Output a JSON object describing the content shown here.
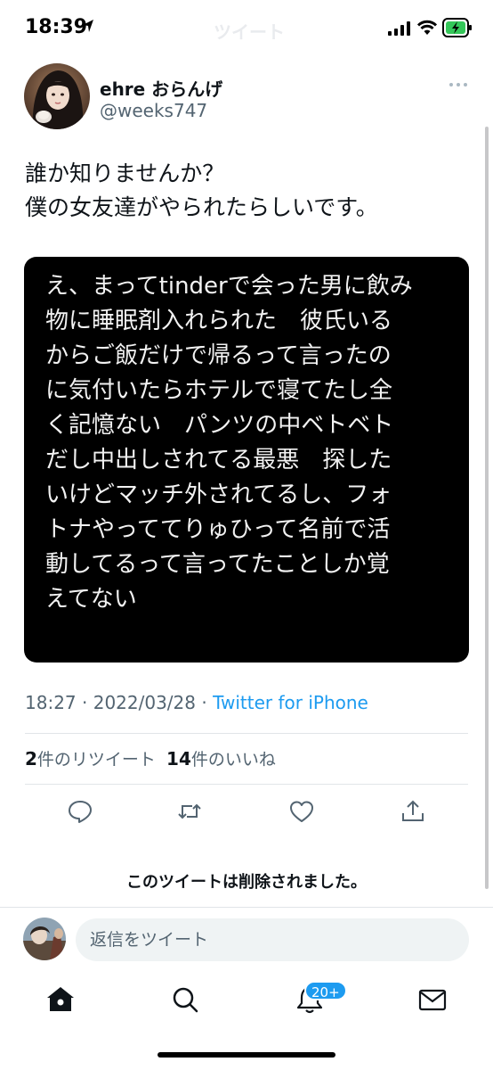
{
  "status_bar": {
    "time": "18:39",
    "ghost_title": "ツイート"
  },
  "tweet": {
    "author": {
      "display_name": "ehre おらんげ",
      "handle": "@weeks747"
    },
    "text_lines": [
      "誰か知りませんか？",
      "僕の女友達がやられたらしいです。"
    ],
    "image_text_lines": [
      "え、まってtinderで会った男に飲み",
      "物に睡眠剤入れられた　彼氏いる",
      "からご飯だけで帰るって言ったの",
      "に気付いたらホテルで寝てたし全",
      "く記憶ない　パンツの中ベトベト",
      "だし中出しされてる最悪　探した",
      "いけどマッチ外されてるし、フォ",
      "トナやっててりゅひって名前で活",
      "動してるって言ってたことしか覚",
      "えてない"
    ],
    "time": "18:27",
    "separator": "·",
    "date": "2022/03/28",
    "source": "Twitter for iPhone",
    "retweet_count": "2",
    "retweet_label": "件のリツイート",
    "like_count": "14",
    "like_label": "件のいいね",
    "deleted_notice": "このツイートは削除されました。"
  },
  "reply": {
    "placeholder": "返信をツイート"
  },
  "tabbar": {
    "notification_badge": "20+"
  },
  "colors": {
    "accent": "#1d9bf0",
    "secondary_text": "#536471",
    "image_background": "#000000"
  }
}
